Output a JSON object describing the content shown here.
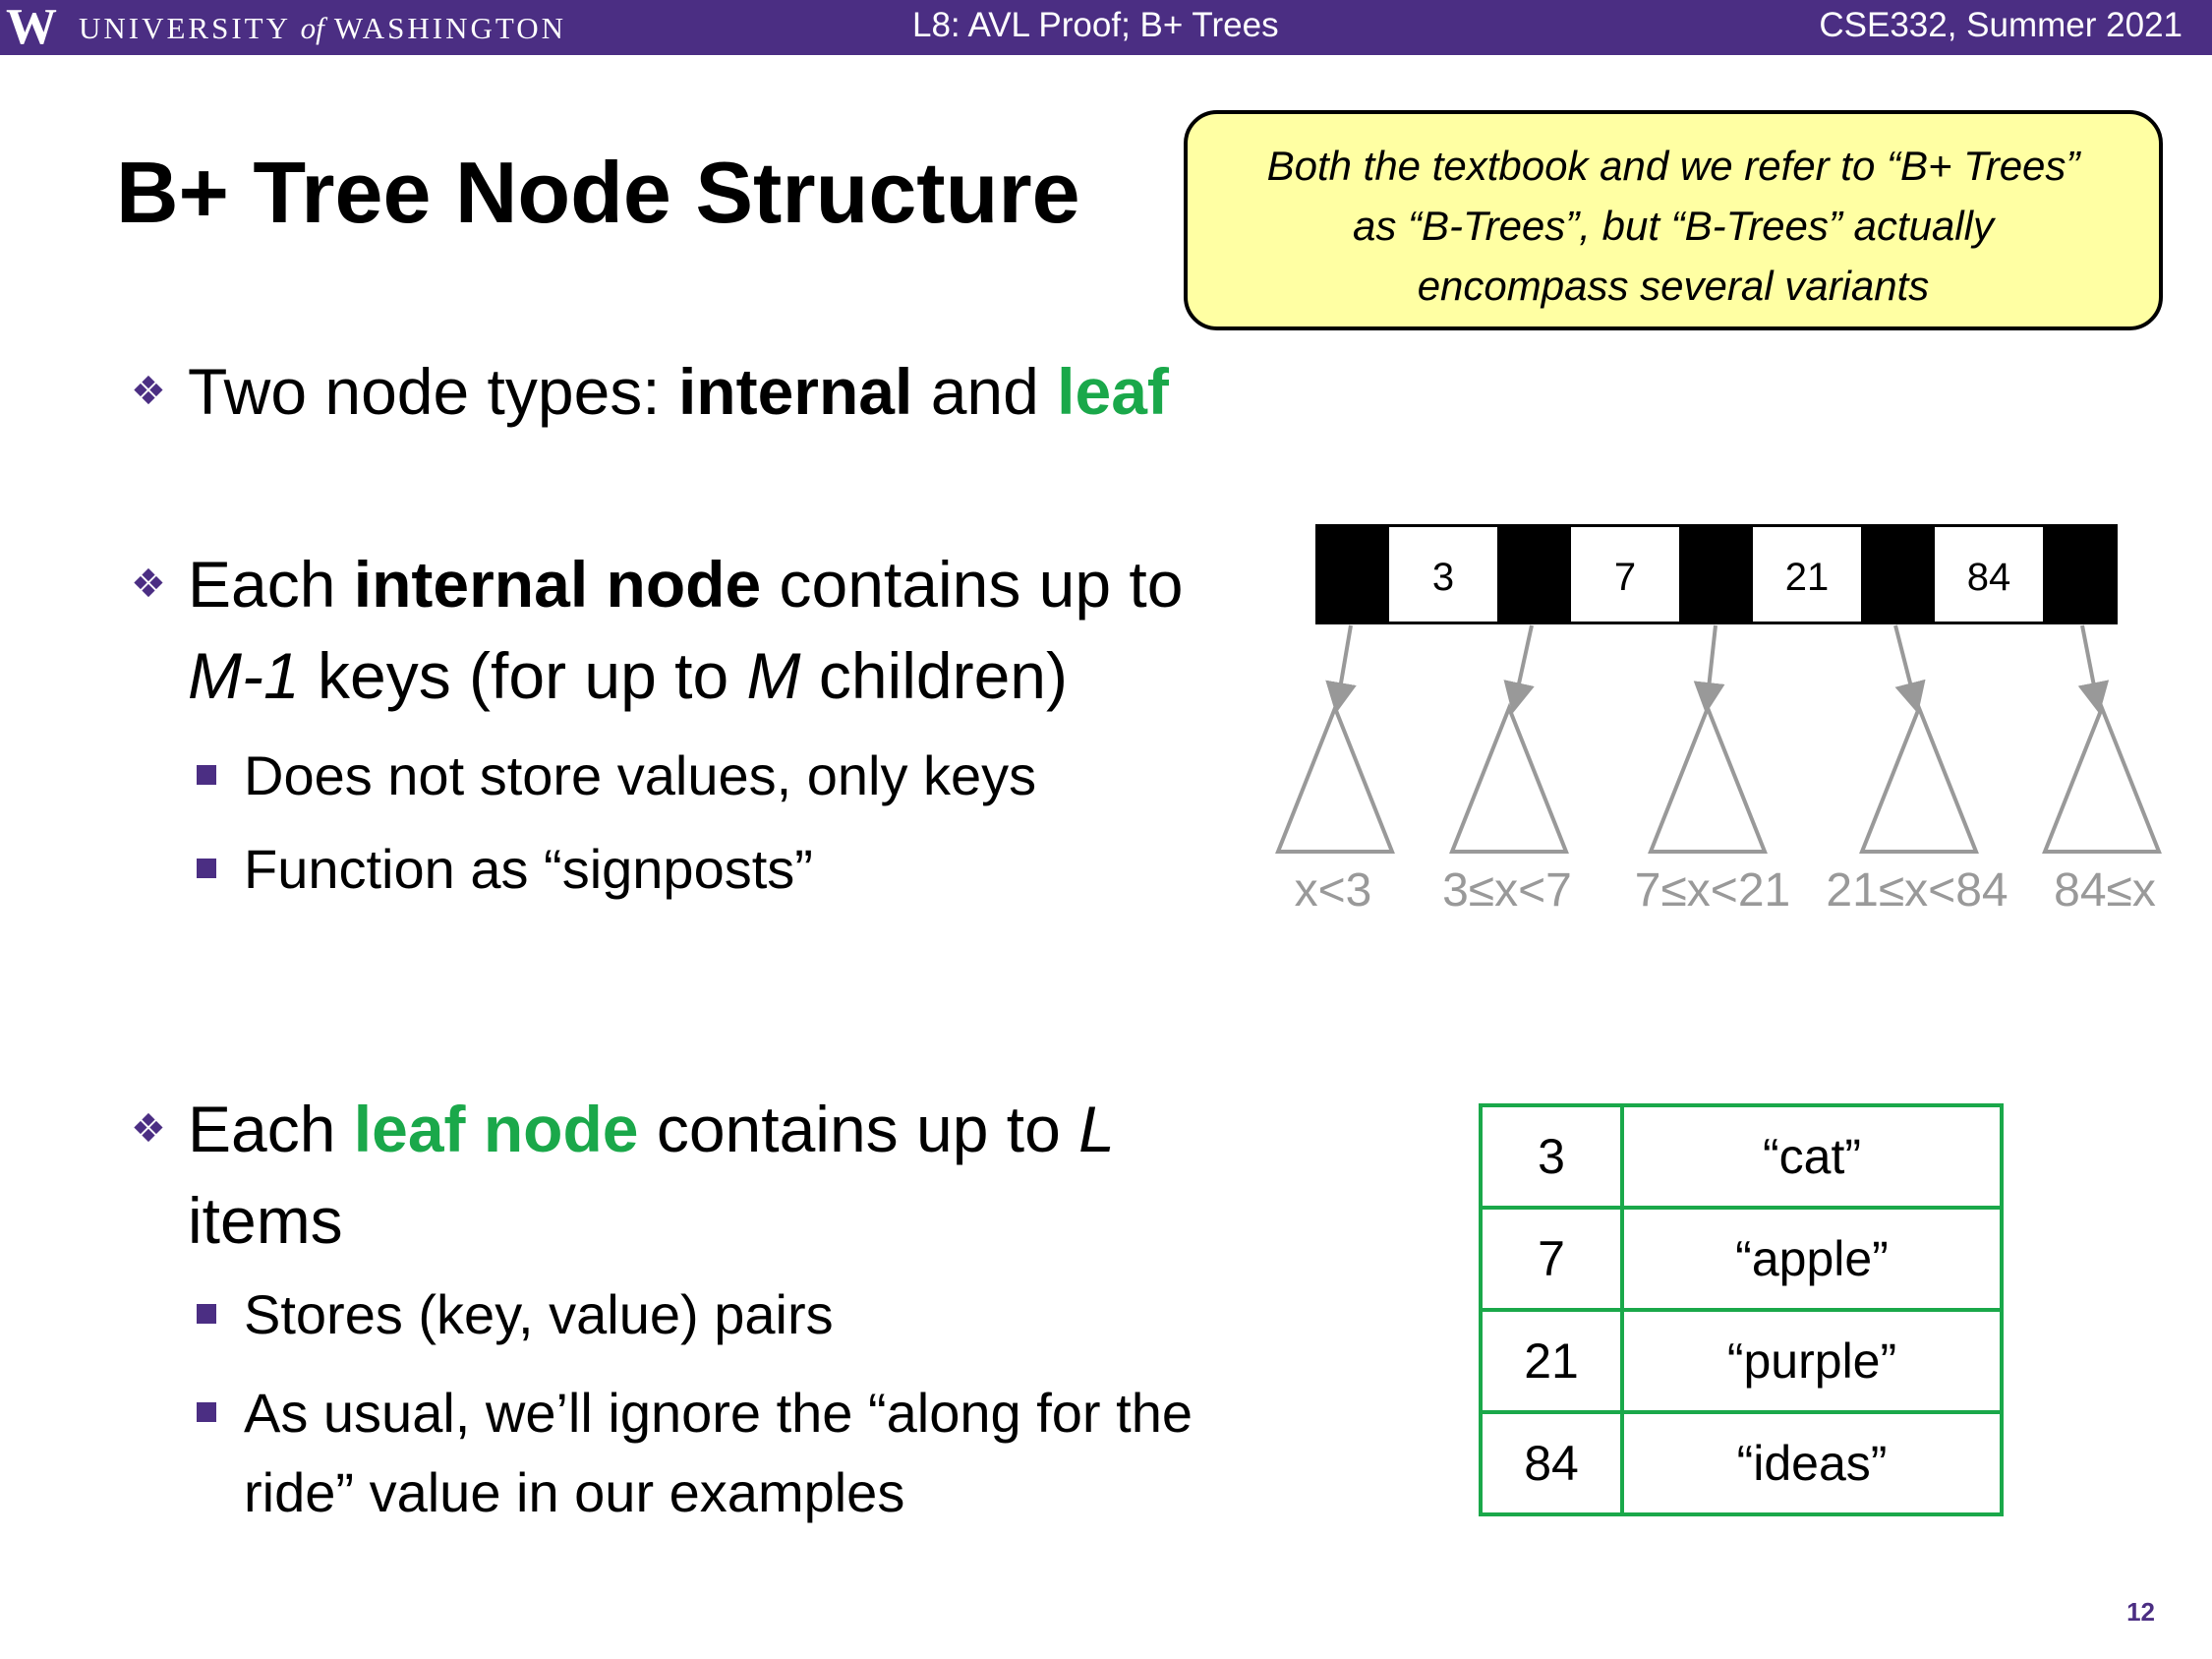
{
  "header": {
    "logo": "W",
    "university_pre": "UNIVERSITY",
    "university_of": "of",
    "university_post": "WASHINGTON",
    "lecture": "L8: AVL Proof; B+ Trees",
    "course": "CSE332, Summer 2021"
  },
  "slide": {
    "title": "B+ Tree Node Structure",
    "callout": {
      "line1": "Both the textbook and we refer to “B+ Trees”",
      "line2": "as “B-Trees”, but “B-Trees” actually",
      "line3": "encompass several variants"
    },
    "bullet1": {
      "text1": "Two node types: ",
      "bold": "internal",
      "text2": " and ",
      "green": "leaf"
    },
    "bullet2": {
      "text1": "Each ",
      "bold": "internal node",
      "text2": " contains up to",
      "m1": "M-1",
      "text3": " keys (for up to ",
      "m2": "M",
      "text4": " children)",
      "subs": [
        "Does not store values, only keys",
        "Function as “signposts”"
      ]
    },
    "bullet3": {
      "text1": "Each ",
      "green": "leaf node",
      "text2": " contains up to ",
      "l": "L",
      "line2": "items",
      "subs": [
        "Stores (key, value) pairs",
        "As usual, we’ll ignore the “along for the",
        "ride” value in our examples"
      ]
    },
    "page_number": "12"
  },
  "internal_node": {
    "keys": [
      "3",
      "7",
      "21",
      "84"
    ],
    "ranges": [
      "x<3",
      "3≤x<7",
      "7≤x<21",
      "21≤x<84",
      "84≤x"
    ]
  },
  "leaf_node": {
    "rows": [
      {
        "key": "3",
        "value": "“cat”"
      },
      {
        "key": "7",
        "value": "“apple”"
      },
      {
        "key": "21",
        "value": "“purple”"
      },
      {
        "key": "84",
        "value": "“ideas”"
      }
    ]
  },
  "colors": {
    "purple": "#4b2e83",
    "green": "#1aa84a",
    "callout_bg": "#ffffa3",
    "gray": "#999999"
  }
}
